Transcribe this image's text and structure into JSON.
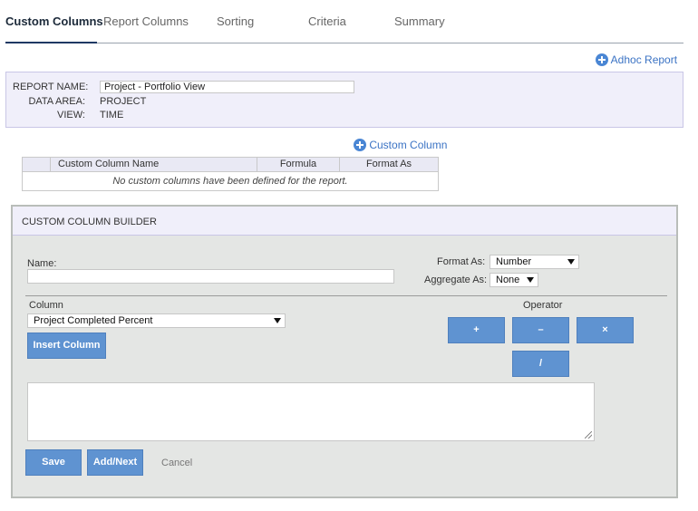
{
  "tabs": [
    {
      "label": "Custom Columns",
      "active": true
    },
    {
      "label": "Report Columns",
      "active": false
    },
    {
      "label": "Sorting",
      "active": false
    },
    {
      "label": "Criteria",
      "active": false
    },
    {
      "label": "Summary",
      "active": false
    }
  ],
  "header": {
    "adhoc_report_link": "Adhoc Report"
  },
  "report_info": {
    "name_label": "REPORT NAME:",
    "name_value": "Project - Portfolio View",
    "data_area_label": "DATA AREA:",
    "data_area_value": "PROJECT",
    "view_label": "VIEW:",
    "view_value": "TIME"
  },
  "custom_columns": {
    "add_link": "Custom Column",
    "headers": [
      "",
      "Custom Column Name",
      "Formula",
      "Format As"
    ],
    "empty_message": "No custom columns have been defined for the report."
  },
  "builder": {
    "title": "CUSTOM COLUMN BUILDER",
    "name_label": "Name:",
    "name_value": "",
    "format_as_label": "Format As:",
    "format_as_value": "Number",
    "aggregate_as_label": "Aggregate As:",
    "aggregate_as_value": "None",
    "column_label": "Column",
    "column_value": "Project Completed Percent",
    "insert_column_button": "Insert Column",
    "operator_label": "Operator",
    "operators": [
      "+",
      "–",
      "×",
      "/"
    ],
    "formula_value": "",
    "save_button": "Save",
    "add_next_button": "Add/Next",
    "cancel_link": "Cancel"
  },
  "colors": {
    "accent": "#5f93d1",
    "link": "#3b73c4",
    "panel_bg": "#f0effa",
    "builder_bg": "#e4e6e4"
  },
  "icons": [
    "plus-circle-icon",
    "chevron-down-icon",
    "resize-grip-icon"
  ]
}
